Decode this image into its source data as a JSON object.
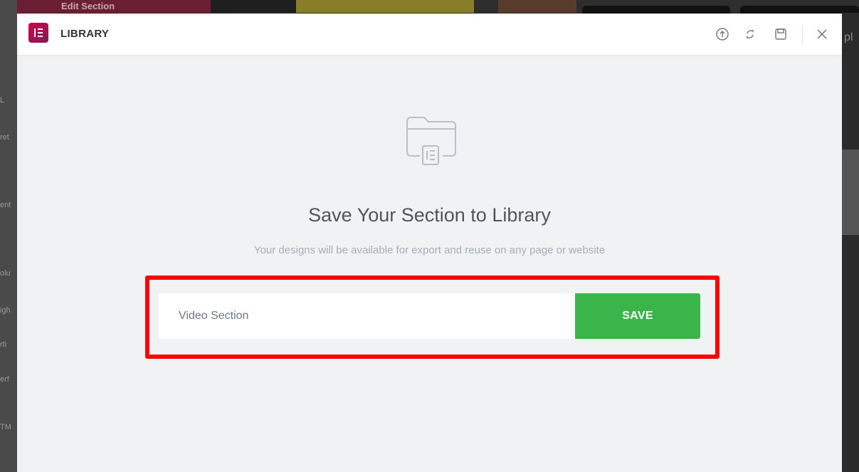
{
  "background": {
    "top_left_label": "Edit Section",
    "right_edge_text": "pl",
    "left_edge_fragments": [
      "L",
      "ret",
      "ent",
      "olu",
      "igh",
      "rti",
      "erf",
      "TM"
    ]
  },
  "modal": {
    "title": "LIBRARY",
    "header_icons": [
      "upload-icon",
      "sync-icon",
      "save-icon",
      "close-icon"
    ],
    "empty_state": {
      "icon": "folder-template-icon",
      "heading": "Save Your Section to Library",
      "description": "Your designs will be available for export and reuse on any page or website"
    },
    "form": {
      "input_value": "Video Section",
      "save_label": "SAVE"
    }
  },
  "colors": {
    "brand": "#92003b",
    "save_button": "#39b54a",
    "highlight": "#ff0000"
  }
}
